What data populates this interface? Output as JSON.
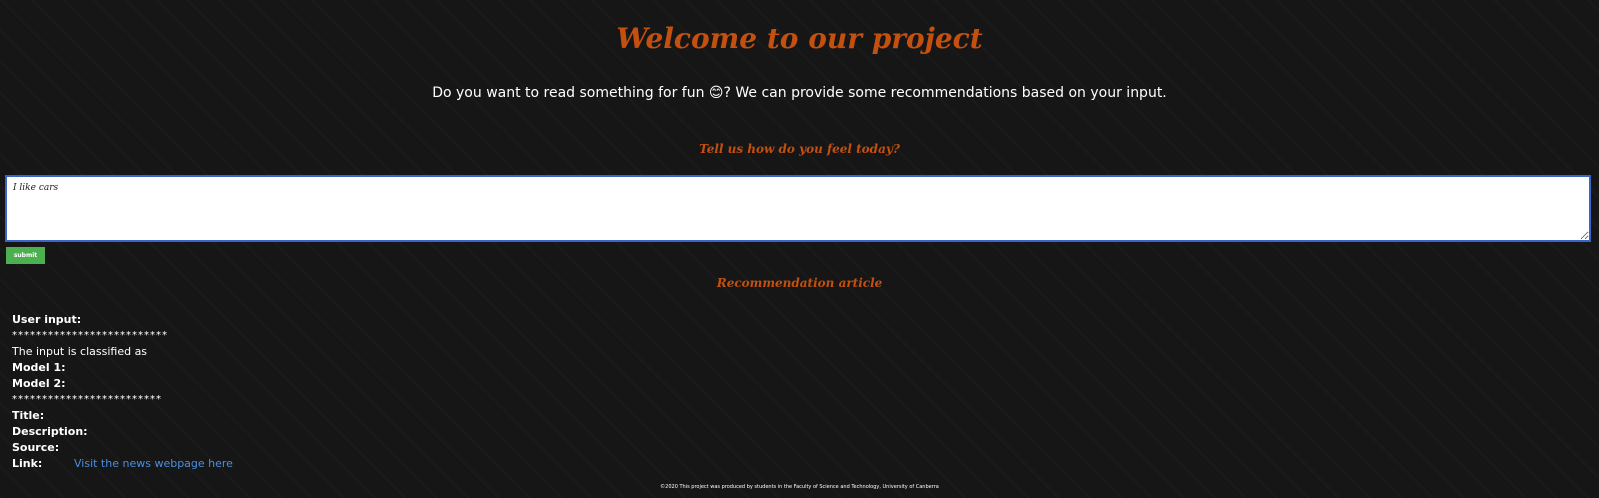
{
  "header": {
    "title": "Welcome to our project",
    "intro": "Do you want to read something for fun 😊? We can provide some recommendations based on your input."
  },
  "input_section": {
    "heading": "Tell us how do you feel today?",
    "textarea_value": "I like cars",
    "submit_label": "submit"
  },
  "recommendation": {
    "heading": "Recommendation article",
    "user_input_label": "User input:",
    "stars_top": "**************************",
    "classified_text": "The input is classified as",
    "model1_label": "Model 1:",
    "model2_label": "Model 2:",
    "stars_bottom": "*************************",
    "title_label": "Title:",
    "description_label": "Description:",
    "source_label": "Source:",
    "link_label": "Link:",
    "link_text": "Visit the news webpage here"
  },
  "footer": {
    "text": "©2020 This project was produced by students in the Faculty of Science and Technology, University of Canberra"
  },
  "colors": {
    "accent": "#c4500f",
    "link": "#4a8fe0",
    "button": "#4caf50",
    "background": "#161616",
    "input_border": "#3a64c8"
  }
}
